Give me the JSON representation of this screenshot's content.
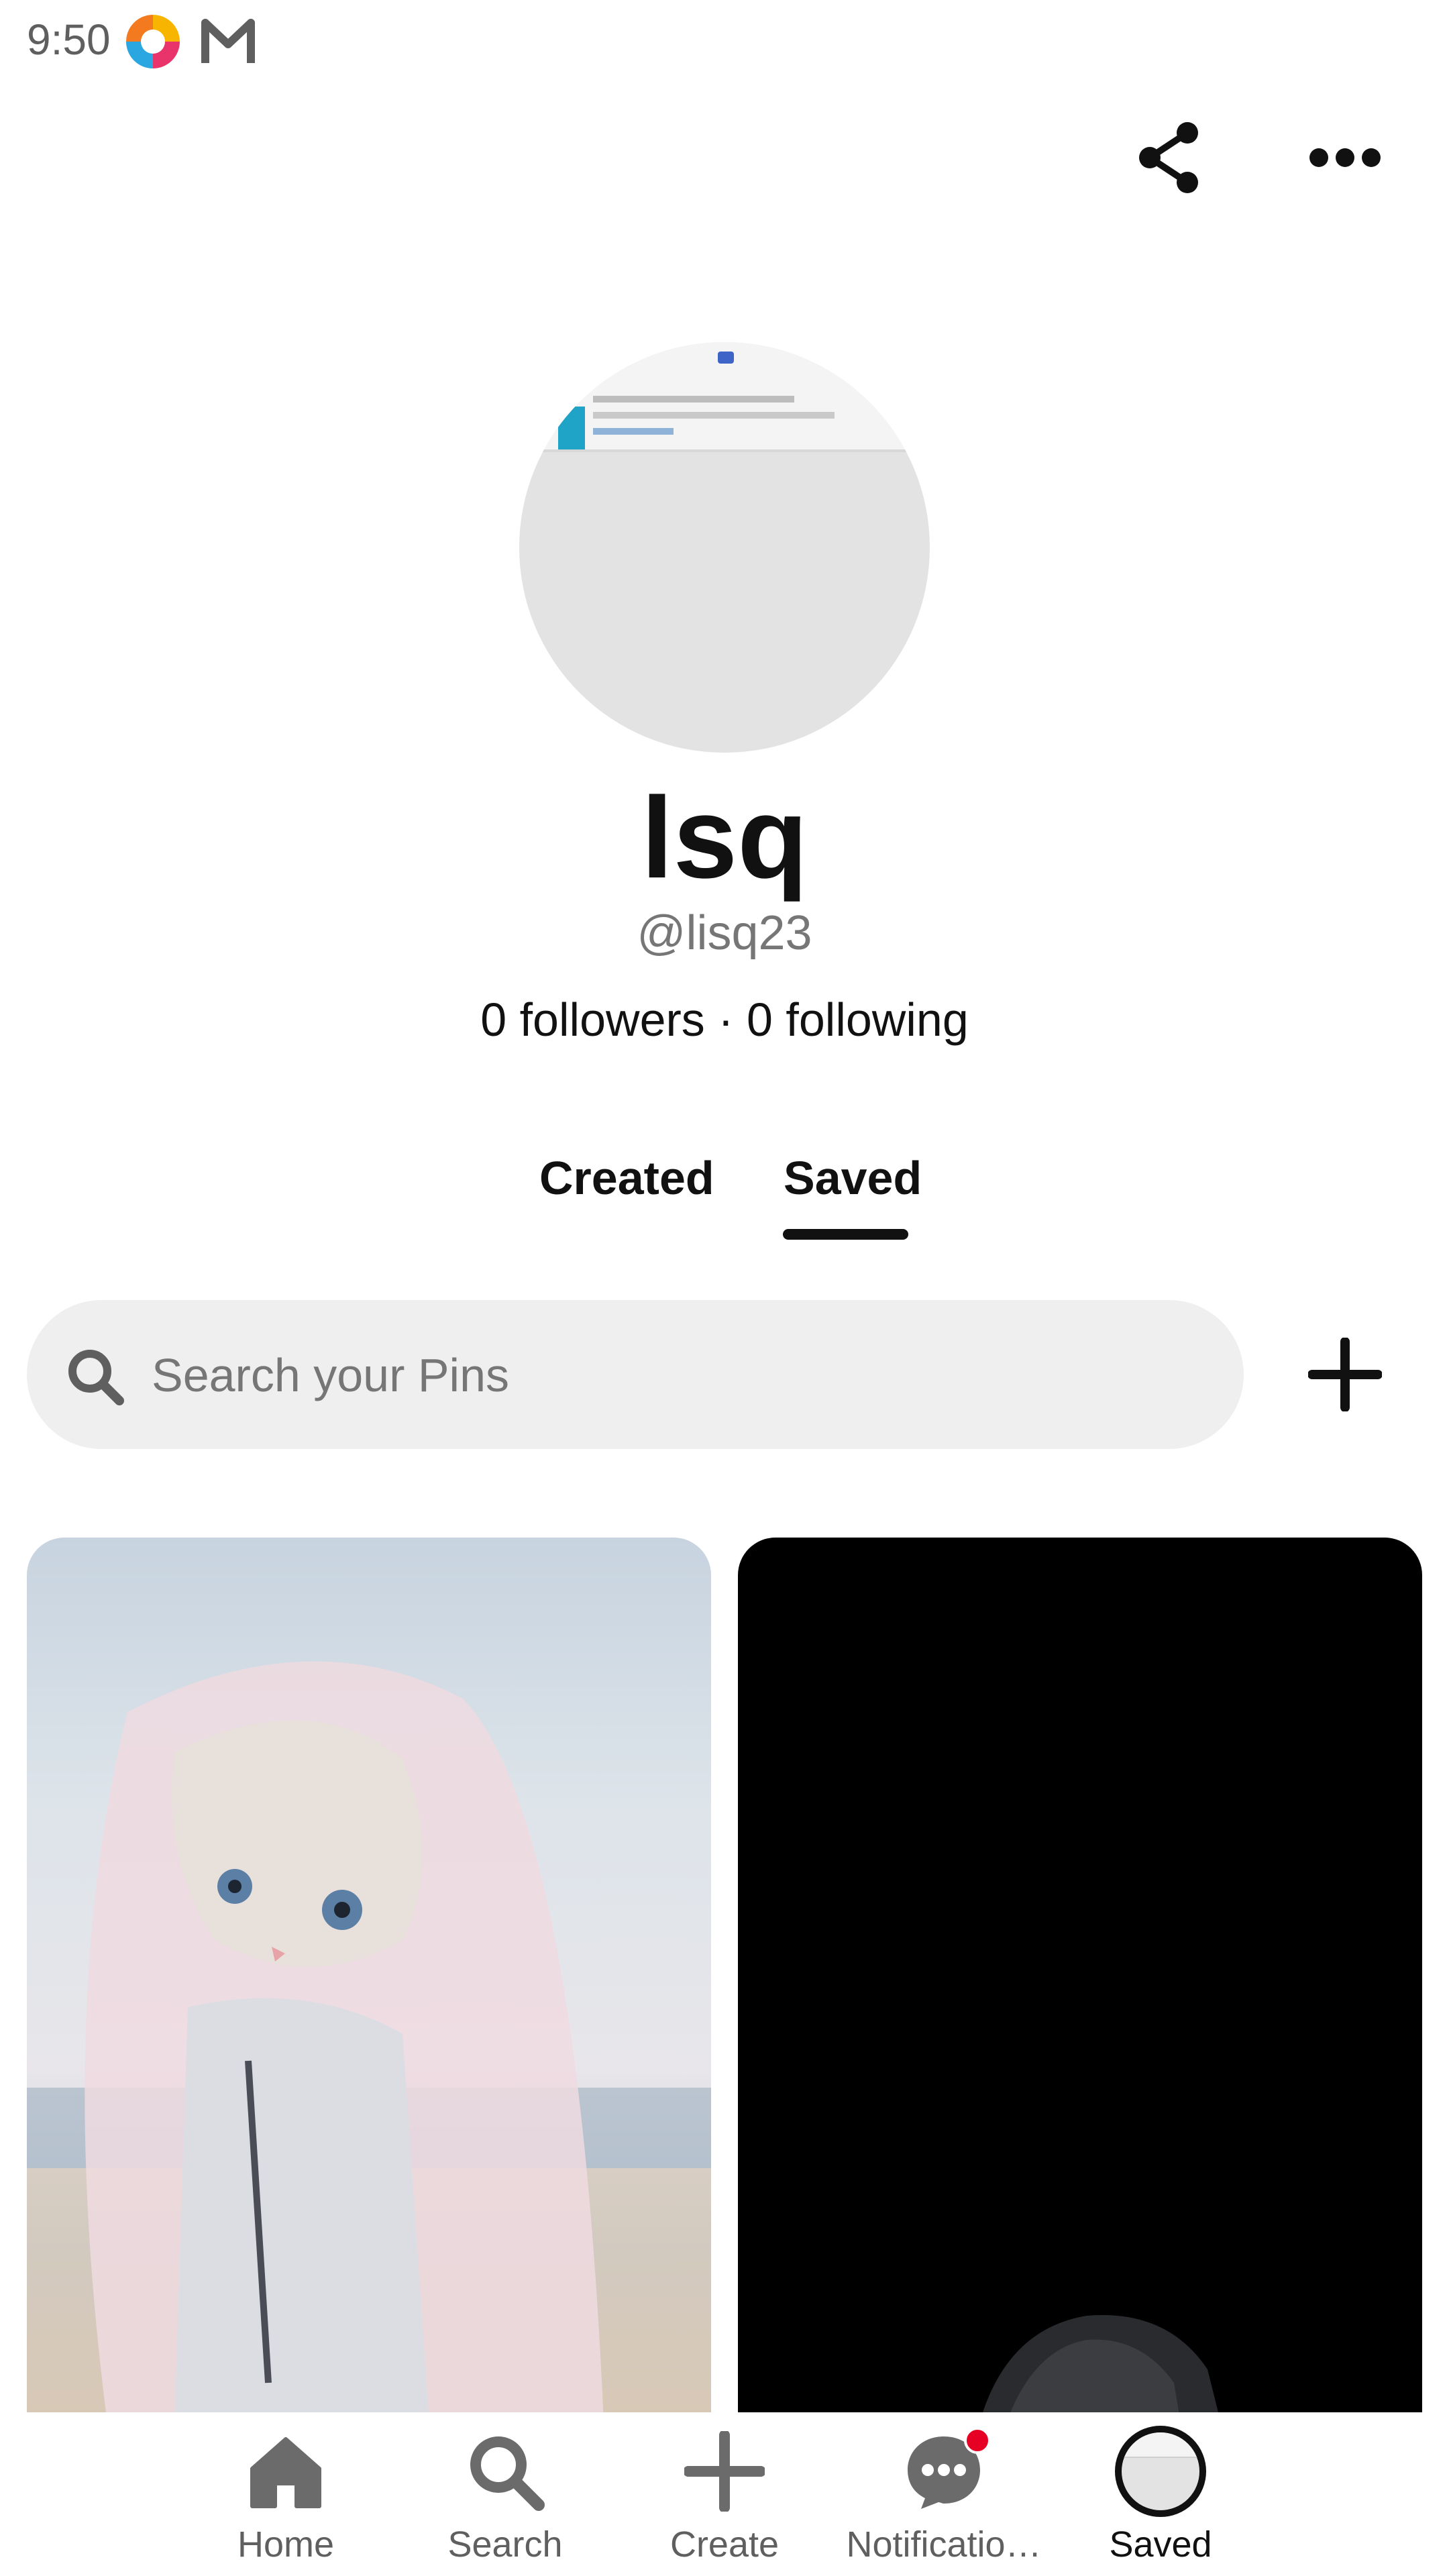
{
  "status_bar": {
    "time": "9:50"
  },
  "header": {
    "icons": [
      "share-icon",
      "more-icon"
    ]
  },
  "profile": {
    "name": "lsq",
    "handle": "@lisq23",
    "followers_text": "0 followers · 0 following"
  },
  "tabs": [
    {
      "label": "Created",
      "active": false
    },
    {
      "label": "Saved",
      "active": true
    }
  ],
  "search": {
    "placeholder": "Search your Pins"
  },
  "bottom_nav": {
    "items": [
      {
        "label": "Home",
        "icon": "home-icon"
      },
      {
        "label": "Search",
        "icon": "search-icon"
      },
      {
        "label": "Create",
        "icon": "plus-icon"
      },
      {
        "label": "Notificatio…",
        "icon": "chat-bubble-icon"
      },
      {
        "label": "Saved",
        "icon": "profile-avatar-icon"
      }
    ]
  },
  "colors": {
    "notification_dot": "#e60023",
    "text_primary": "#111111",
    "text_secondary": "#767676",
    "search_bg": "#efefef"
  }
}
